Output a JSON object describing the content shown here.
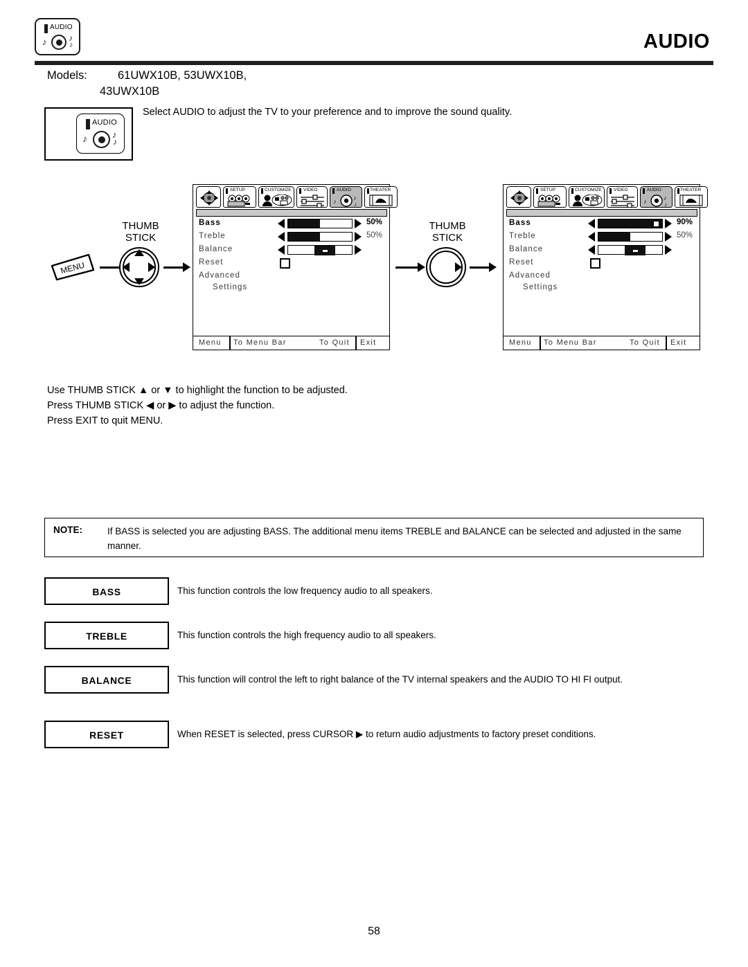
{
  "header": {
    "title": "AUDIO",
    "badge": {
      "label": "AUDIO",
      "icon": "audio-disc-icon"
    }
  },
  "models": {
    "label": "Models:",
    "line1": "61UWX10B, 53UWX10B,",
    "line2": "43UWX10B"
  },
  "intro": {
    "icon_label": "AUDIO",
    "text": "Select AUDIO to adjust the TV to your preference and to improve the sound quality."
  },
  "flow": {
    "menu_key_label": "MENU",
    "thumbstick_label_line1": "THUMB",
    "thumbstick_label_line2": "STICK"
  },
  "osd": {
    "tabs": [
      {
        "name": "",
        "icon": "dpad-icon"
      },
      {
        "name": "SETUP",
        "icon": "setup-camcorder-icon"
      },
      {
        "name": "CUSTOMIZE",
        "icon": "customize-person-icon"
      },
      {
        "name": "VIDEO",
        "icon": "video-sliders-icon"
      },
      {
        "name": "AUDIO",
        "icon": "audio-disc-icon",
        "selected": true
      },
      {
        "name": "THEATER",
        "icon": "theater-film-icon"
      }
    ],
    "footer": {
      "menu": "Menu",
      "to_menu_bar": "To Menu Bar",
      "to_quit": "To Quit",
      "exit": "Exit"
    },
    "panel_before": {
      "rows": [
        {
          "label": "Bass",
          "active": true,
          "type": "slider",
          "value": 50,
          "value_text": "50%"
        },
        {
          "label": "Treble",
          "active": false,
          "type": "slider",
          "value": 50,
          "value_text": "50%"
        },
        {
          "label": "Balance",
          "active": false,
          "type": "balance",
          "value": 50,
          "value_text": ""
        },
        {
          "label": "Reset",
          "active": false,
          "type": "checkbox"
        },
        {
          "label": "Advanced",
          "active": false,
          "type": "text"
        },
        {
          "label": "Settings",
          "active": false,
          "type": "text-indent"
        }
      ]
    },
    "panel_after": {
      "rows": [
        {
          "label": "Bass",
          "active": true,
          "type": "slider",
          "value": 90,
          "value_text": "90%"
        },
        {
          "label": "Treble",
          "active": false,
          "type": "slider",
          "value": 50,
          "value_text": "50%"
        },
        {
          "label": "Balance",
          "active": false,
          "type": "balance",
          "value": 50,
          "value_text": ""
        },
        {
          "label": "Reset",
          "active": false,
          "type": "checkbox"
        },
        {
          "label": "Advanced",
          "active": false,
          "type": "text"
        },
        {
          "label": "Settings",
          "active": false,
          "type": "text-indent"
        }
      ]
    }
  },
  "instructions": {
    "line1": "Use THUMB STICK ▲ or ▼ to highlight the function to be adjusted.",
    "line2": "Press THUMB STICK ◀ or ▶ to adjust the function.",
    "line3": "Press EXIT to quit MENU."
  },
  "note": {
    "label": "NOTE:",
    "text": "If BASS is selected you are adjusting BASS.  The additional menu items TREBLE and BALANCE can be selected and adjusted in the same manner."
  },
  "definitions": [
    {
      "term": "BASS",
      "description": "This function controls the low frequency audio to all speakers."
    },
    {
      "term": "TREBLE",
      "description": "This function controls the high frequency audio to all speakers."
    },
    {
      "term": "BALANCE",
      "description": "This function will control the left to right balance of the TV internal speakers and the AUDIO TO HI FI output."
    },
    {
      "term": "RESET",
      "description": "When RESET is selected, press CURSOR ▶ to return audio adjustments to factory preset conditions."
    }
  ],
  "page_number": "58",
  "colors": {
    "rule": "#231f20",
    "selected_tab": "#b8b8b8",
    "slider_fill": "#111111"
  }
}
